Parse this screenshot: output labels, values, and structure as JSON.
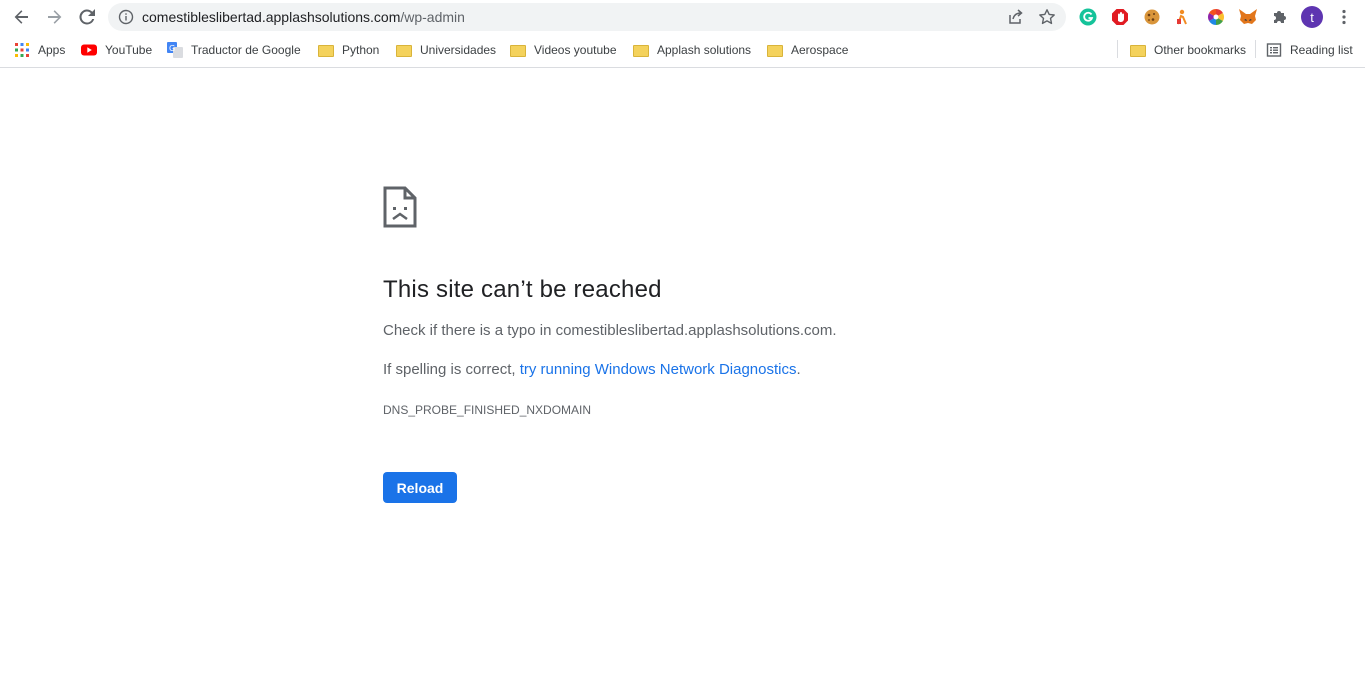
{
  "browser": {
    "url_host": "comestibleslibertad.applashsolutions.com",
    "url_path": "/wp-admin",
    "profile_initial": "t",
    "accent_color": "#1a73e8",
    "avatar_color": "#5e35b1"
  },
  "bookmarks": {
    "left": [
      {
        "label": "Apps",
        "icon": "apps-grid-icon"
      },
      {
        "label": "YouTube",
        "icon": "youtube-icon"
      },
      {
        "label": "Traductor de Google",
        "icon": "google-translate-icon"
      },
      {
        "label": "Python",
        "icon": "folder-icon"
      },
      {
        "label": "Universidades",
        "icon": "folder-icon"
      },
      {
        "label": "Videos youtube",
        "icon": "folder-icon"
      },
      {
        "label": "Applash solutions",
        "icon": "folder-icon"
      },
      {
        "label": "Aerospace",
        "icon": "folder-icon"
      }
    ],
    "other": "Other bookmarks",
    "reading_list": "Reading list"
  },
  "error": {
    "title": "This site can’t be reached",
    "typo_line": "Check if there is a typo in comestibleslibertad.applashsolutions.com.",
    "spelling_prefix": "If spelling is correct, ",
    "diagnostics_link": "try running Windows Network Diagnostics",
    "spelling_suffix": ".",
    "code": "DNS_PROBE_FINISHED_NXDOMAIN",
    "reload_label": "Reload"
  }
}
